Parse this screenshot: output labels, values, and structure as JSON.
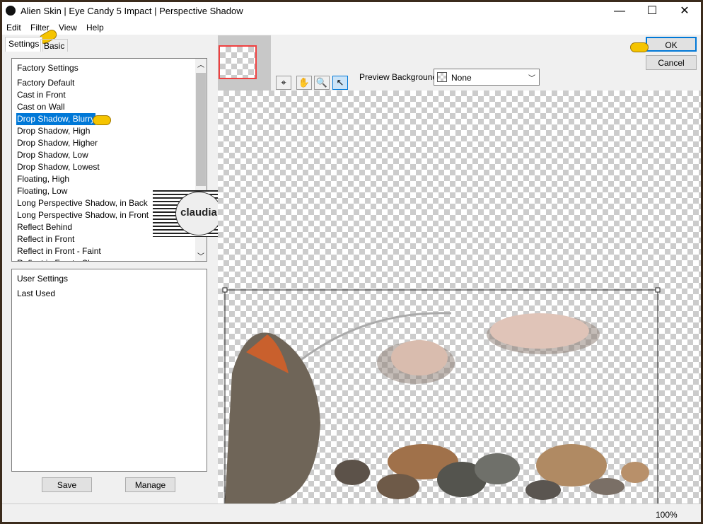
{
  "window": {
    "title": "Alien Skin | Eye Candy 5 Impact | Perspective Shadow",
    "minimize": "—",
    "maximize": "☐",
    "close": "✕"
  },
  "menu": [
    "Edit",
    "Filter",
    "View",
    "Help"
  ],
  "tabs": [
    "Settings",
    "Basic"
  ],
  "factory": {
    "header": "Factory Settings",
    "items": [
      "Factory Default",
      "Cast in Front",
      "Cast on Wall",
      "Drop Shadow, Blurry",
      "Drop Shadow, High",
      "Drop Shadow, Higher",
      "Drop Shadow, Low",
      "Drop Shadow, Lowest",
      "Floating, High",
      "Floating, Low",
      "Long Perspective Shadow, in Back",
      "Long Perspective Shadow, in Front",
      "Reflect Behind",
      "Reflect in Front",
      "Reflect in Front - Faint",
      "Reflect in Front - Sharp"
    ],
    "selected": "Drop Shadow, Blurry"
  },
  "user": {
    "header": "User Settings",
    "items": [
      "Last Used"
    ]
  },
  "buttons": {
    "save": "Save",
    "manage": "Manage",
    "ok": "OK",
    "cancel": "Cancel"
  },
  "preview": {
    "background_label": "Preview Background:",
    "background_value": "None"
  },
  "tools": [
    "navigate-icon",
    "hand-icon",
    "zoom-icon",
    "pointer-icon"
  ],
  "watermark": "claudia",
  "status": {
    "zoom": "100%"
  },
  "colors": {
    "selection": "#0078d7",
    "ok_border": "#0078d7",
    "thumb_frame": "#f04040"
  }
}
